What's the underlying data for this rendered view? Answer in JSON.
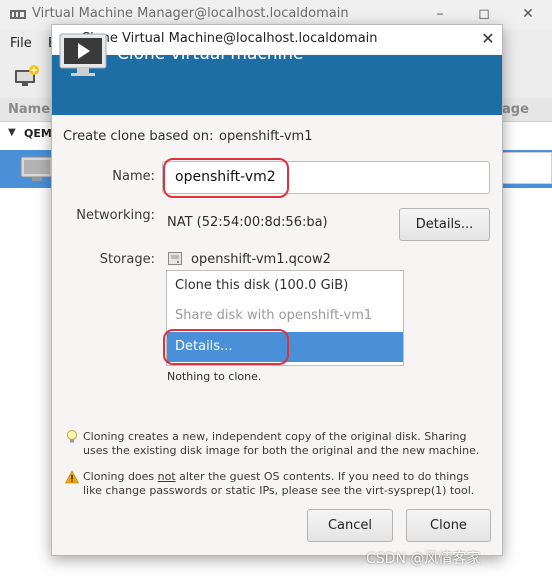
{
  "background_window": {
    "title": "Virtual Machine Manager@localhost.localdomain",
    "menu_file": "File",
    "menu_truncated": "E",
    "column_name": "Name",
    "column_usage": "age",
    "group_label": "QEMU",
    "selected_row_color": "#4a90d9"
  },
  "dialog": {
    "title": "Clone Virtual Machine@localhost.localdomain",
    "banner_title": "Clone virtual machine",
    "banner_color": "#1c6ea4",
    "clone_based_on_label": "Create clone based on:",
    "clone_based_on_value": "openshift-vm1",
    "name_label": "Name:",
    "name_value": "openshift-vm2",
    "networking_label": "Networking:",
    "networking_value": "NAT (52:54:00:8d:56:ba)",
    "networking_details_button": "Details...",
    "storage_label": "Storage:",
    "storage_disk": "openshift-vm1.qcow2",
    "storage_menu": [
      {
        "label": "Clone this disk (100.0 GiB)",
        "state": "normal"
      },
      {
        "label": "Share disk with openshift-vm1",
        "state": "disabled"
      },
      {
        "label": "Details...",
        "state": "selected"
      }
    ],
    "nothing_to_clone": "Nothing to clone.",
    "info_note": {
      "line1": "Cloning creates a new, independent copy of the original disk. Sharing",
      "line2": "uses the existing disk image for both the original and the new machine."
    },
    "warning_note": {
      "line1_before": "Cloning does ",
      "line1_emph": "not",
      "line1_after": " alter the guest OS contents. If you need to do things",
      "line2": "like change passwords or static IPs, please see the virt-sysprep(1) tool."
    },
    "cancel_button": "Cancel",
    "clone_button": "Clone",
    "highlight_color": "#e0313d"
  },
  "watermark": "CSDN @风情客家"
}
